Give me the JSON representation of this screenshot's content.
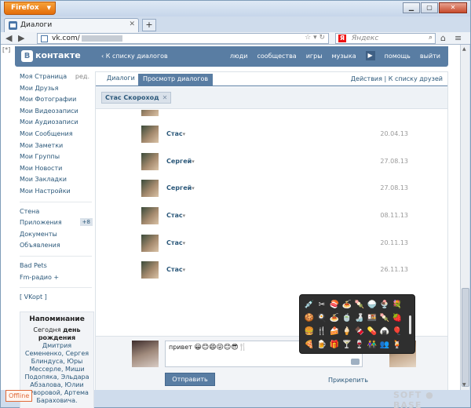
{
  "browser": {
    "app_button": "Firefox",
    "tab_title": "Диалоги",
    "url_prefix": "vk.com/",
    "search_placeholder": "Яндекс"
  },
  "header": {
    "logo_text": "контакте",
    "logo_letter": "В",
    "bracket": "[*]",
    "back_link": "‹ К списку диалогов",
    "nav": [
      "люди",
      "сообщества",
      "игры",
      "музыка",
      "помощь",
      "выйти"
    ]
  },
  "sidebar": {
    "items": [
      {
        "label": "Моя Страница",
        "extra": "ред."
      },
      {
        "label": "Мои Друзья"
      },
      {
        "label": "Мои Фотографии"
      },
      {
        "label": "Мои Видеозаписи"
      },
      {
        "label": "Мои Аудиозаписи"
      },
      {
        "label": "Мои Сообщения"
      },
      {
        "label": "Мои Заметки"
      },
      {
        "label": "Мои Группы"
      },
      {
        "label": "Мои Новости"
      },
      {
        "label": "Мои Закладки"
      },
      {
        "label": "Мои Настройки"
      }
    ],
    "items2": [
      {
        "label": "Стена"
      },
      {
        "label": "Приложения",
        "extra": "+8"
      },
      {
        "label": "Документы"
      },
      {
        "label": "Объявления"
      }
    ],
    "items3": [
      {
        "label": "Bad Pets"
      },
      {
        "label": "Fm-радио +"
      }
    ],
    "items4": [
      {
        "label": "[ VKopt ]"
      }
    ],
    "reminder": {
      "title": "Напоминание",
      "text_a": "Сегодня ",
      "text_b": "день рождения",
      "text_c": " Дмитрия Семененко, Сергея Блиндуса, Юры Мессерле, Миши Подопяка, Эльдара Абзалова, Юлии Суворовой, Артема Бараховича."
    }
  },
  "main": {
    "tabs": [
      "Диалоги",
      "Просмотр диалогов"
    ],
    "actions": "Действия",
    "friends_link": "К списку друзей",
    "chip": "Стас Скороход",
    "messages": [
      {
        "name": "",
        "date": ""
      },
      {
        "name": "Стас",
        "date": "20.04.13"
      },
      {
        "name": "Сергей",
        "date": "27.08.13"
      },
      {
        "name": "Сергей",
        "date": "27.08.13"
      },
      {
        "name": "Стас",
        "date": "08.11.13"
      },
      {
        "name": "Стас",
        "date": "20.11.13"
      },
      {
        "name": "Стас",
        "date": "26.11.13"
      }
    ],
    "compose": {
      "text": "привет",
      "emoji": "😀😊😄😜😊😎🍴",
      "send": "Отправить",
      "attach": "Прикрепить"
    }
  },
  "emoji_picker": [
    "💉",
    "✂",
    "🍣",
    "🍝",
    "🍡",
    "🍚",
    "🍨",
    "💐",
    "🍪",
    "🍳",
    "🍝",
    "🍵",
    "🍶",
    "🍱",
    "🍡",
    "🍓",
    "🍔",
    "🍴",
    "🍰",
    "🍦",
    "🍫",
    "💊",
    "🍙",
    "🎈",
    "🍕",
    "🍺",
    "🎁",
    "🍸",
    "🍷",
    "👫",
    "👥",
    "🍹"
  ],
  "footer": {
    "offline": "Offline",
    "watermark": "SOFT ● BASE"
  }
}
